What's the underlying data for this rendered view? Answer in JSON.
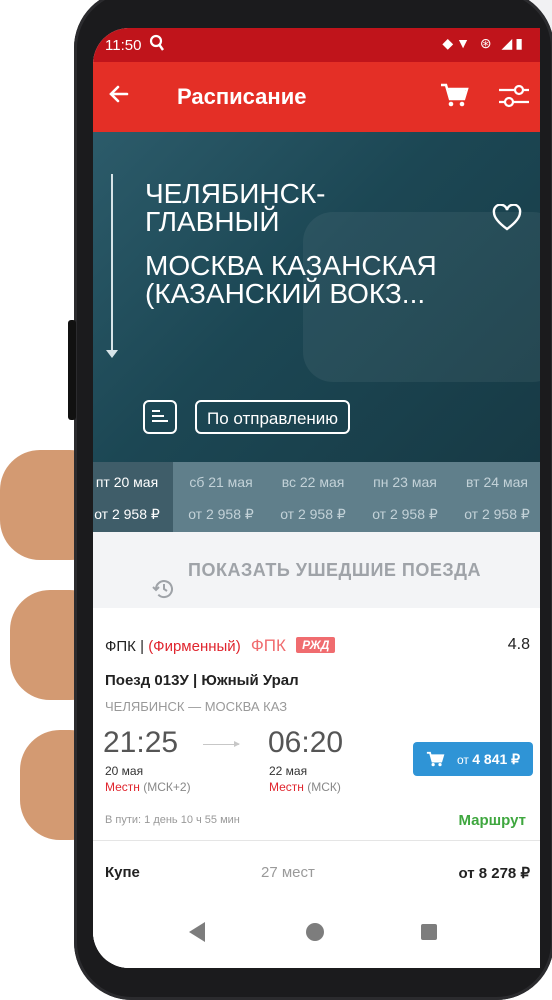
{
  "status_bar": {
    "time": "11:50",
    "icons": "◆▼ ⊛ ◢▮"
  },
  "toolbar": {
    "title": "Расписание"
  },
  "hero": {
    "from": "ЧЕЛЯБИНСК-ГЛАВНЫЙ",
    "to": "МОСКВА КАЗАНСКАЯ (КАЗАНСКИЙ ВОКЗ...",
    "sort_label": "По отправлению"
  },
  "dates": [
    {
      "date": "пт 20 мая",
      "price": "от 2 958 ₽",
      "selected": true
    },
    {
      "date": "сб 21 мая",
      "price": "от 2 958 ₽",
      "selected": false
    },
    {
      "date": "вс 22 мая",
      "price": "от 2 958 ₽",
      "selected": false
    },
    {
      "date": "пн 23 мая",
      "price": "от 2 958 ₽",
      "selected": false
    },
    {
      "date": "вт 24 мая",
      "price": "от 2 958 ₽",
      "selected": false
    }
  ],
  "show_past_label": "ПОКАЗАТЬ УШЕДШИЕ ПОЕЗДА",
  "train_card": {
    "carrier": "ФПК",
    "separator": "|",
    "type": "(Фирменный)",
    "fpk_logo": "ФПК",
    "rzd_logo": "РЖД",
    "rating": "4.8",
    "train_name": "Поезд 013У  |  Южный Урал",
    "route": "ЧЕЛЯБИНСК — МОСКВА КАЗ",
    "departure_time": "21:25",
    "arrival_time": "06:20",
    "departure_date": "20 мая",
    "arrival_date": "22 мая",
    "departure_tz_label": "Местн",
    "departure_tz": " (МСК+2)",
    "arrival_tz_label": "Местн",
    "arrival_tz": " (МСК)",
    "buy_prefix": "от",
    "buy_price": "4 841 ₽",
    "travel_time": "В пути: 1 день 10 ч 55 мин",
    "route_link": "Маршрут",
    "class_name": "Купе",
    "seats": "27 мест",
    "class_price": "от 8 278 ₽"
  },
  "colors": {
    "toolbar": "#e42f26",
    "status_bar": "#c0141b",
    "buy_button": "#2f94d6",
    "route_link": "#3fa73f",
    "accent_red": "#e0252e"
  }
}
